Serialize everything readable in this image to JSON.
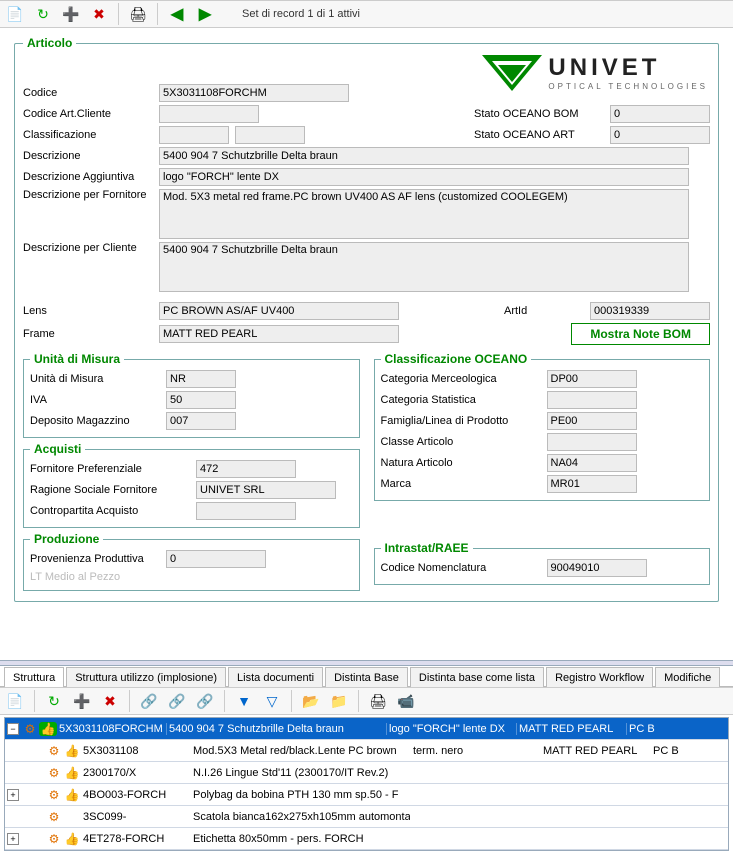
{
  "top_toolbar": {
    "record_label": "Set di record 1 di 1 attivi"
  },
  "article": {
    "legend": "Articolo",
    "logo_main": "UNIVET",
    "logo_sub": "OPTICAL TECHNOLOGIES",
    "fields": {
      "codice_label": "Codice",
      "codice": "5X3031108FORCHM",
      "codice_art_cliente_label": "Codice Art.Cliente",
      "codice_art_cliente": "",
      "classificazione_label": "Classificazione",
      "classificazione": "",
      "stato_bom_label": "Stato OCEANO BOM",
      "stato_bom": "0",
      "stato_art_label": "Stato OCEANO ART",
      "stato_art": "0",
      "descrizione_label": "Descrizione",
      "descrizione": "5400 904 7 Schutzbrille Delta braun",
      "descrizione_agg_label": "Descrizione Aggiuntiva",
      "descrizione_agg": "logo \"FORCH\" lente DX",
      "descrizione_forn_label": "Descrizione per Fornitore",
      "descrizione_forn": "Mod. 5X3 metal red frame.PC brown UV400 AS AF lens (customized COOLEGEM)",
      "descrizione_cli_label": "Descrizione per Cliente",
      "descrizione_cli": "5400 904 7 Schutzbrille Delta braun",
      "lens_label": "Lens",
      "lens": "PC BROWN AS/AF UV400",
      "frame_label": "Frame",
      "frame": "MATT RED PEARL",
      "artid_label": "ArtId",
      "artid": "000319339",
      "btn_note": "Mostra Note BOM"
    },
    "unita": {
      "legend": "Unità di Misura",
      "um_label": "Unità di Misura",
      "um": "NR",
      "iva_label": "IVA",
      "iva": "50",
      "dep_label": "Deposito Magazzino",
      "dep": "007"
    },
    "oceano": {
      "legend": "Classificazione OCEANO",
      "cat_merc_label": "Categoria Merceologica",
      "cat_merc": "DP00",
      "cat_stat_label": "Categoria Statistica",
      "cat_stat": "",
      "fam_label": "Famiglia/Linea di Prodotto",
      "fam": "PE00",
      "classe_label": "Classe Articolo",
      "classe": "",
      "natura_label": "Natura Articolo",
      "natura": "NA04",
      "marca_label": "Marca",
      "marca": "MR01"
    },
    "acquisti": {
      "legend": "Acquisti",
      "forn_pref_label": "Fornitore Preferenziale",
      "forn_pref": "472",
      "rag_soc_label": "Ragione Sociale Fornitore",
      "rag_soc": "UNIVET SRL",
      "contro_label": "Contropartita Acquisto",
      "contro": ""
    },
    "produzione": {
      "legend": "Produzione",
      "prov_label": "Provenienza Produttiva",
      "prov": "0",
      "lt_label": "LT Medio al Pezzo"
    },
    "intrastat": {
      "legend": "Intrastat/RAEE",
      "cod_nom_label": "Codice Nomenclatura",
      "cod_nom": "90049010"
    }
  },
  "bottom": {
    "tabs": [
      "Struttura",
      "Struttura utilizzo (implosione)",
      "Lista documenti",
      "Distinta Base",
      "Distinta base come lista",
      "Registro Workflow",
      "Modifiche"
    ],
    "rows": [
      {
        "expand": "-",
        "indent": 0,
        "code": "5X3031108FORCHM",
        "desc": "5400 904 7 Schutzbrille Delta braun",
        "extra": "logo \"FORCH\" lente DX",
        "col4": "MATT RED PEARL",
        "col5": "PC B",
        "selected": true,
        "ic2": "green"
      },
      {
        "expand": "",
        "indent": 1,
        "code": "5X3031108",
        "desc": "Mod.5X3 Metal red/black.Lente PC brown",
        "extra": "term. nero",
        "col4": "MATT RED PEARL",
        "col5": "PC B",
        "selected": false,
        "ic2": "green"
      },
      {
        "expand": "",
        "indent": 1,
        "code": "2300170/X",
        "desc": "N.I.26 Lingue Std'11 (2300170/IT Rev.2)",
        "extra": "",
        "col4": "",
        "col5": "",
        "selected": false,
        "ic2": "green"
      },
      {
        "expand": "+",
        "indent": 1,
        "code": "4BO003-FORCH",
        "desc": "Polybag da bobina PTH 130 mm sp.50 -  F",
        "extra": "",
        "col4": "",
        "col5": "",
        "selected": false,
        "ic2": "green"
      },
      {
        "expand": "",
        "indent": 1,
        "code": "3SC099-",
        "desc": "Scatola bianca162x275xh105mm automontan",
        "extra": "",
        "col4": "",
        "col5": "",
        "selected": false,
        "ic2": "none"
      },
      {
        "expand": "+",
        "indent": 1,
        "code": "4ET278-FORCH",
        "desc": "Etichetta 80x50mm - pers. FORCH",
        "extra": "",
        "col4": "",
        "col5": "",
        "selected": false,
        "ic2": "green"
      }
    ]
  }
}
